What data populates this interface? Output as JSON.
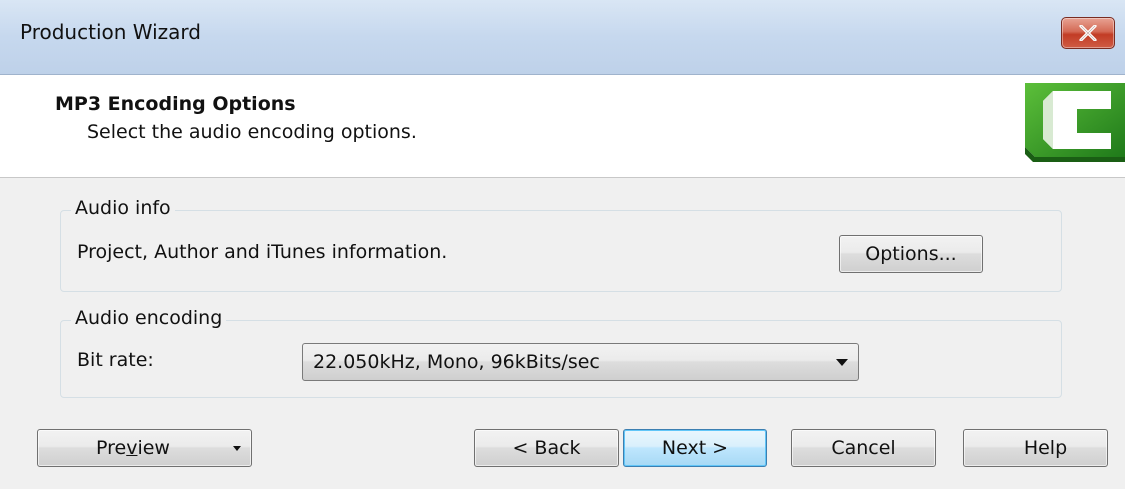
{
  "window": {
    "title": "Production Wizard"
  },
  "header": {
    "title": "MP3 Encoding Options",
    "subtitle": "Select the audio encoding options."
  },
  "audio_info": {
    "legend": "Audio info",
    "description": "Project, Author and iTunes information.",
    "options_label": "Options..."
  },
  "audio_encoding": {
    "legend": "Audio encoding",
    "bitrate_label": "Bit rate:",
    "bitrate_value": "22.050kHz, Mono, 96kBits/sec"
  },
  "footer": {
    "preview_pre": "Pre",
    "preview_mnemonic": "v",
    "preview_post": "iew",
    "back_label": "< Back",
    "next_label": "Next >",
    "cancel_label": "Cancel",
    "help_label": "Help"
  },
  "icons": {
    "close": "close-icon",
    "logo": "camtasia-logo",
    "dropdown": "chevron-down-icon"
  },
  "colors": {
    "close_button": "#c23c25",
    "logo_green": "#3e9b2c",
    "default_button_border": "#3c7fb1"
  }
}
